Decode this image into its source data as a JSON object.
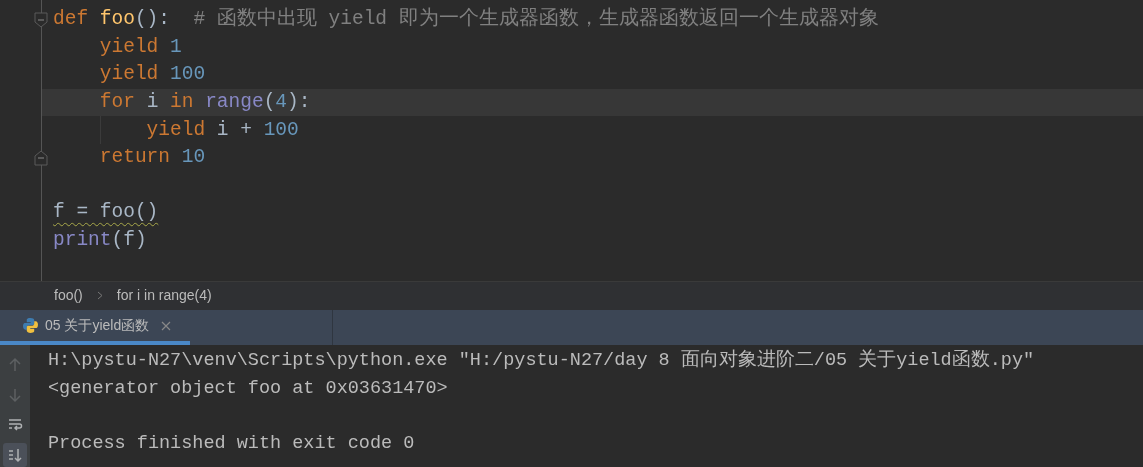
{
  "editor": {
    "lines": [
      {
        "current": false,
        "fold_start": true,
        "fold_end": false,
        "tokens": [
          {
            "kind": "keyword",
            "text": "def "
          },
          {
            "kind": "funcdef",
            "text": "foo"
          },
          {
            "kind": "plain",
            "text": "():  "
          },
          {
            "kind": "comment",
            "text": "# 函数中出现 yield 即为一个生成器函数，生成器函数返回一个生成器对象"
          }
        ]
      },
      {
        "current": false,
        "fold_start": false,
        "fold_end": false,
        "tokens": [
          {
            "kind": "keyword",
            "text": "    yield "
          },
          {
            "kind": "number",
            "text": "1"
          }
        ]
      },
      {
        "current": false,
        "fold_start": false,
        "fold_end": false,
        "tokens": [
          {
            "kind": "keyword",
            "text": "    yield "
          },
          {
            "kind": "number",
            "text": "100"
          }
        ]
      },
      {
        "current": true,
        "fold_start": false,
        "fold_end": false,
        "tokens": [
          {
            "kind": "keyword",
            "text": "    for "
          },
          {
            "kind": "plain",
            "text": "i "
          },
          {
            "kind": "keyword",
            "text": "in "
          },
          {
            "kind": "builtin",
            "text": "range"
          },
          {
            "kind": "plain",
            "text": "("
          },
          {
            "kind": "number",
            "text": "4"
          },
          {
            "kind": "plain",
            "text": "):"
          }
        ]
      },
      {
        "current": false,
        "fold_start": false,
        "fold_end": false,
        "guide": true,
        "tokens": [
          {
            "kind": "keyword",
            "text": "        yield "
          },
          {
            "kind": "plain",
            "text": "i + "
          },
          {
            "kind": "number",
            "text": "100"
          }
        ]
      },
      {
        "current": false,
        "fold_start": false,
        "fold_end": true,
        "tokens": [
          {
            "kind": "keyword",
            "text": "    return "
          },
          {
            "kind": "number",
            "text": "10"
          }
        ]
      },
      {
        "current": false,
        "fold_start": false,
        "fold_end": false
      },
      {
        "current": false,
        "fold_start": false,
        "fold_end": false,
        "warning": true,
        "tokens": [
          {
            "kind": "plain",
            "text": "f = foo()"
          }
        ]
      },
      {
        "current": false,
        "fold_start": false,
        "fold_end": false,
        "tokens": [
          {
            "kind": "builtin",
            "text": "print"
          },
          {
            "kind": "plain",
            "text": "(f)"
          }
        ]
      }
    ]
  },
  "breadcrumbs": [
    "foo()",
    "for i in range(4)"
  ],
  "run_tabs": [
    {
      "label": "05 关于yield函数",
      "selected": true
    }
  ],
  "console": {
    "toolbar": [
      {
        "kind": "up",
        "disabled": true
      },
      {
        "kind": "down",
        "disabled": true
      },
      {
        "kind": "wrap",
        "selected": false
      },
      {
        "kind": "scroll_end",
        "selected": true
      }
    ],
    "lines": [
      {
        "kind": "command",
        "text": "H:\\pystu-N27\\venv\\Scripts\\python.exe \"H:/pystu-N27/day 8 面向对象进阶二/05 关于yield函数.py\""
      },
      {
        "kind": "output",
        "text": "<generator object foo at 0x03631470>"
      },
      {
        "kind": "exit",
        "text": "Process finished with exit code 0"
      }
    ]
  }
}
